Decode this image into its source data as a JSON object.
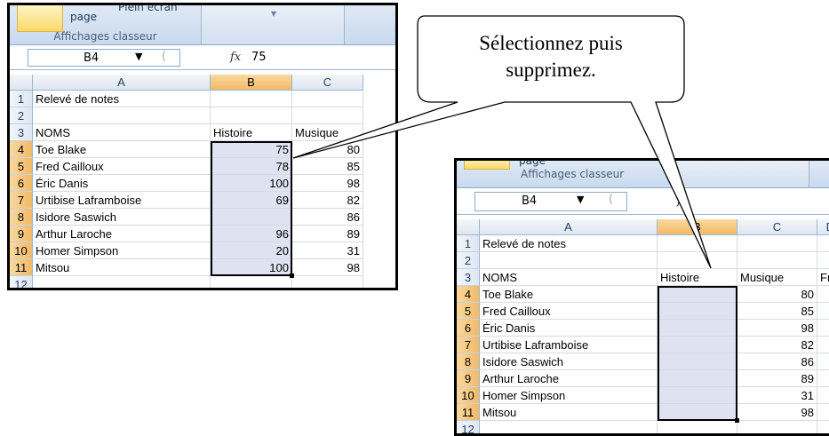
{
  "left": {
    "ribbon": {
      "page_label": "page",
      "fullscreen_label": "Plein écran",
      "group_label": "Affichages classeur"
    },
    "namebox": "B4",
    "fx_label": "fx",
    "formula": "75",
    "columns": [
      "A",
      "B",
      "C"
    ],
    "rows": [
      {
        "n": "1",
        "a": "Relevé de notes",
        "b": "",
        "c": ""
      },
      {
        "n": "2",
        "a": "",
        "b": "",
        "c": ""
      },
      {
        "n": "3",
        "a": "NOMS",
        "b": "Histoire",
        "c": "Musique"
      },
      {
        "n": "4",
        "a": "Toe Blake",
        "b": "75",
        "c": "80"
      },
      {
        "n": "5",
        "a": "Fred Cailloux",
        "b": "78",
        "c": "85"
      },
      {
        "n": "6",
        "a": "Éric Danis",
        "b": "100",
        "c": "98"
      },
      {
        "n": "7",
        "a": "Urtibise Laframboise",
        "b": "69",
        "c": "82"
      },
      {
        "n": "8",
        "a": "Isidore Saswich",
        "b": "",
        "c": "86"
      },
      {
        "n": "9",
        "a": "Arthur Laroche",
        "b": "96",
        "c": "89"
      },
      {
        "n": "10",
        "a": "Homer Simpson",
        "b": "20",
        "c": "31"
      },
      {
        "n": "11",
        "a": "Mitsou",
        "b": "100",
        "c": "98"
      },
      {
        "n": "12",
        "a": "",
        "b": "",
        "c": ""
      }
    ]
  },
  "right": {
    "ribbon": {
      "page_label": "page",
      "group_label": "Affichages classeur"
    },
    "namebox": "B4",
    "fx_label": "fx",
    "formula": "",
    "columns": [
      "A",
      "B",
      "C",
      "D"
    ],
    "col_d_partial": "Fr",
    "rows": [
      {
        "n": "1",
        "a": "Relevé de notes",
        "b": "",
        "c": ""
      },
      {
        "n": "2",
        "a": "",
        "b": "",
        "c": ""
      },
      {
        "n": "3",
        "a": "NOMS",
        "b": "Histoire",
        "c": "Musique"
      },
      {
        "n": "4",
        "a": "Toe Blake",
        "b": "",
        "c": "80"
      },
      {
        "n": "5",
        "a": "Fred Cailloux",
        "b": "",
        "c": "85"
      },
      {
        "n": "6",
        "a": "Éric Danis",
        "b": "",
        "c": "98"
      },
      {
        "n": "7",
        "a": "Urtibise Laframboise",
        "b": "",
        "c": "82"
      },
      {
        "n": "8",
        "a": "Isidore Saswich",
        "b": "",
        "c": "86"
      },
      {
        "n": "9",
        "a": "Arthur Laroche",
        "b": "",
        "c": "89"
      },
      {
        "n": "10",
        "a": "Homer Simpson",
        "b": "",
        "c": "31"
      },
      {
        "n": "11",
        "a": "Mitsou",
        "b": "",
        "c": "98"
      },
      {
        "n": "12",
        "a": "",
        "b": "",
        "c": ""
      }
    ]
  },
  "callout": {
    "text": "Sélectionnez puis supprimez."
  }
}
